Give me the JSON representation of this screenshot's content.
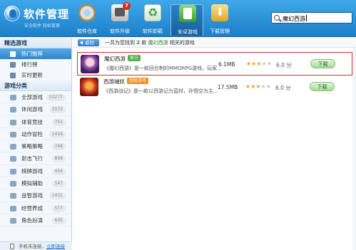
{
  "header": {
    "app_title": "软件管理",
    "app_subtitle": "安全软件 轻松管理",
    "tools": [
      {
        "label": "软件仓库",
        "icon": "disc-store-icon"
      },
      {
        "label": "软件升级",
        "icon": "upgrade-icon",
        "badge": "7"
      },
      {
        "label": "软件卸载",
        "icon": "recycle-icon"
      },
      {
        "label": "安卓游戏",
        "icon": "android-game-icon"
      },
      {
        "label": "下载管理",
        "icon": "download-icon"
      }
    ],
    "search_value": "魔幻西游"
  },
  "sidebar": {
    "section_featured": "精选游戏",
    "featured_items": [
      {
        "label": "热门推荐",
        "icon": "hot-icon"
      },
      {
        "label": "排行榜",
        "icon": "chart-icon"
      },
      {
        "label": "实时更新",
        "icon": "clock-icon"
      }
    ],
    "section_categories": "游戏分类",
    "categories": [
      {
        "label": "全部游戏",
        "count": "10277"
      },
      {
        "label": "休闲游戏",
        "count": "2572"
      },
      {
        "label": "体育竞技",
        "count": "751"
      },
      {
        "label": "动作冒险",
        "count": "1416"
      },
      {
        "label": "策略策略",
        "count": "748"
      },
      {
        "label": "射击飞行",
        "count": "898"
      },
      {
        "label": "棋牌游戏",
        "count": "456"
      },
      {
        "label": "模拟辅助",
        "count": "147"
      },
      {
        "label": "益智游戏",
        "count": "1431"
      },
      {
        "label": "经营养成",
        "count": "577"
      },
      {
        "label": "角色扮演",
        "count": "605"
      }
    ],
    "status_text": "手机未连接，",
    "status_link": "立即连接"
  },
  "main": {
    "back_label": "返回",
    "result_prefix": "一共为您找到",
    "result_count": "2",
    "result_mid": "款",
    "result_keyword": "魔幻西游",
    "result_suffix": "相关的游戏",
    "items": [
      {
        "name": "魔幻西游",
        "tag": "官方",
        "desc": "《魔幻西游》是一款回合制的MMORPG游戏，玩家...",
        "size": "6.1MB",
        "rating": 3,
        "score": "6.0 分",
        "download_label": "下载"
      },
      {
        "name": "西游捕妖",
        "tag": "超级游戏",
        "desc": "《西游战记》是一款以西游记为蓝材，孙悟空为主...",
        "size": "17.5MB",
        "rating": 3,
        "score": "6.0 分",
        "download_label": "下载"
      }
    ]
  },
  "colors": {
    "header_blue": "#1d7fc9",
    "selected_blue": "#2d85cf",
    "highlight_red": "#e02a2a",
    "star_gold": "#f0a21c",
    "tag_green": "#56b04a",
    "tag_orange": "#f08a1a"
  }
}
